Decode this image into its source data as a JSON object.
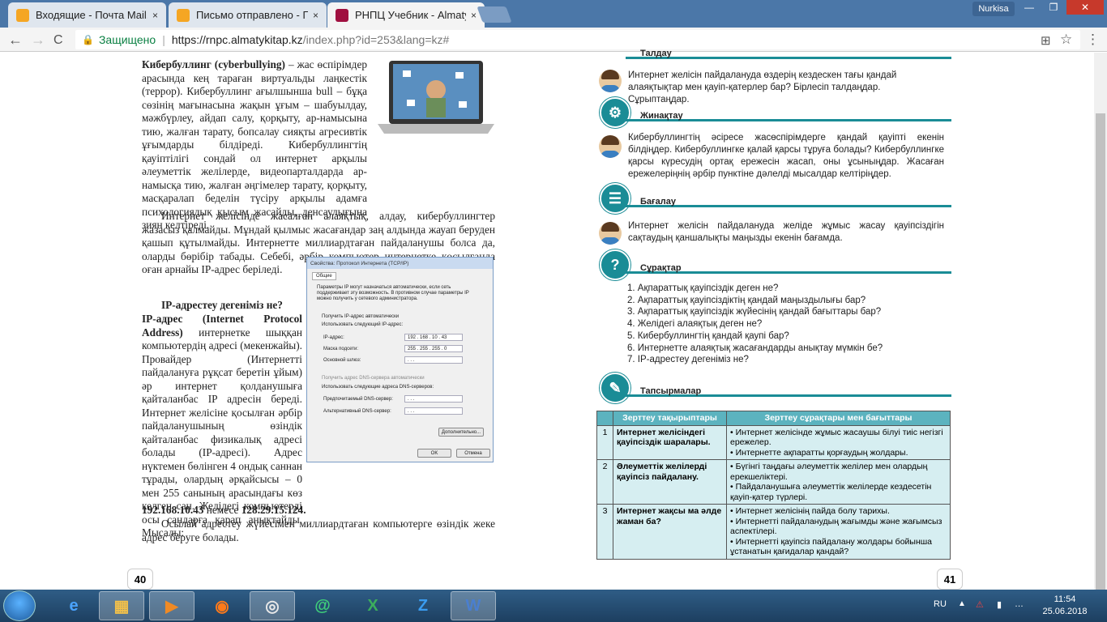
{
  "browser": {
    "tabs": [
      {
        "label": "Входящие - Почта Mail.F",
        "close": "×",
        "color": "#f5a623"
      },
      {
        "label": "Письмо отправлено - П",
        "close": "×",
        "color": "#f5a623"
      },
      {
        "label": "РНПЦ Учебник - Almaty",
        "close": "×",
        "color": "#a01040"
      }
    ],
    "user": "Nurkisa",
    "win_min": "—",
    "win_max": "❐",
    "win_close": "✕",
    "back": "←",
    "forward": "→",
    "reload": "C",
    "secure_label": "Защищено",
    "url_host": "https://rnpc.almatykitap.kz",
    "url_path": "/index.php?id=253&lang=kz#",
    "translate_icon": "⊞",
    "star_icon": "☆",
    "menu_icon": "⋮"
  },
  "left_page": {
    "p1_bold": "Кибербуллинг (cyberbullying)",
    "p1": " – жас өспірімдер арасында кең тараған виртуальды лаңкестік (террор). Кибербуллинг ағылшынша bull – бұқа сөзінің мағынасына жақын ұғым – шабуылдау, мәжбүрлеу, айдап салу, қорқыту, ар-намысына тию, жалған тарату, бопсалау сияқты агресивтік ұғымдарды білдіреді. Кибербуллингтің қауіптілігі сондай ол интернет арқылы әлеуметтік желілерде, видеопарталдарда ар-намысқа тию, жалған әңгімелер тарату, қорқыту, масқаралап беделін түсіру арқылы адамға психологиялық қысым жасайды, денсаулығына зиян келтіреді.",
    "p2": "Интернет желісінде жасалған алаяқтық, алдау, кибербуллингтер жазасыз қалмайды. Мұндай қылмыс жасағандар заң алдында жауап беруден қашып құтылмайды. Интернетте миллиардтаған пайдаланушы болса да, оларды бөрібір табады. Себебі, әрбір компьютер интернетке қосылғанда оған арнайы IP-адрес беріледі.",
    "p3": "IP-адрестеу дегеніміз не?",
    "p4_bold": "IP-адрес (Internet Protocol Address)",
    "p4": " интернетке шыққан компьютердің адресі (мекенжайы). Провайдер (Интернетті пайдалануға рұқсат беретін ұйым) әр интернет қолданушыға қайталанбас IP адресін береді. Интернет желісіне қосылған әрбір пайдаланушының өзіндік қайталанбас физикалық адресі болады (IP-адресі). Адрес нүктемен бөлінген 4 ондық саннан тұрады, олардың әрқайсысы – 0 мен 255 санының арасындағы көз келген сан. Желідегі компьютерді осы сандарға қарап анықтайды. Мысалы:",
    "p4_ex1": "192.168.10.43",
    "p4_or": " немесе ",
    "p4_ex2": "128.29.15.124.",
    "p5": "Осылай адрестеу жүйесімен миллиардтаған компьютерге өзіндік жеке адрес беруге болады.",
    "page_number": "40"
  },
  "ip_dialog": {
    "title": "Свойства: Протокол Интернета (TCP/IP)",
    "tab": "Общие",
    "desc": "Параметры IP могут назначаться автоматически, если сеть поддерживает эту возможность. В противном случае параметры IP можно получить у сетевого администратора.",
    "auto_ip": "Получить IP-адрес автоматически",
    "manual_ip": "Использовать следующий IP-адрес:",
    "ip_label": "IP-адрес:",
    "ip_value": "192 . 168 . 10 . 43",
    "mask_label": "Маска подсети:",
    "mask_value": "255 . 255 . 255 . 0",
    "gw_label": "Основной шлюз:",
    "gw_value": ". . .",
    "auto_dns": "Получить адрес DNS-сервера автоматически",
    "manual_dns": "Использовать следующие адреса DNS-серверов:",
    "dns1_label": "Предпочитаемый DNS-сервер:",
    "dns2_label": "Альтернативный DNS-сервер:",
    "dns_value": ". . .",
    "advanced": "Дополнительно...",
    "ok": "OK",
    "cancel": "Отмена"
  },
  "right_page": {
    "s1_title": "Талдау",
    "s1_text": "Интернет желісін пайдалануда өздерің кездескен тағы қандай алаяқтықтар мен қауіп-қатерлер бар? Бірлесіп талдаңдар. Сұрыптаңдар.",
    "s2_title": "Жинақтау",
    "s2_text": "Кибербуллингтің әсіресе жасөспірімдерге қандай қауіпті екенін білдіңдер. Кибербуллингке қалай қарсы тұруға болады? Кибербуллингке қарсы күресудің ортақ ережесін жасап, оны ұсыныңдар. Жасаған ережелеріңнің әрбір пунктіне дәлелді мысалдар келтіріңдер.",
    "s3_title": "Бағалау",
    "s3_text": "Интернет желісін пайдалануда желіде жұмыс жасау қауіпсіздігін сақтаудың қаншалықты маңызды екенін бағамда.",
    "s4_title": "Сұрақтар",
    "s4_icon": "?",
    "questions": [
      "1. Ақпараттық қауіпсіздік деген не?",
      "2. Ақпараттық қауіпсіздіктің қандай маңыздылығы бар?",
      "3. Ақпараттық қауіпсіздік жүйесінің қандай бағыттары бар?",
      "4. Желідегі алаяқтық деген не?",
      "5. Кибербуллингтің қандай қаупі бар?",
      "6. Интернетте алаяқтық жасағандарды анықтау мүмкін бе?",
      "7. IP-адрестеу дегеніміз не?"
    ],
    "s5_title": "Тапсырмалар",
    "table_headers": [
      "",
      "Зерттеу тақырыптары",
      "Зерттеу сұрақтары мен бағыттары"
    ],
    "table_rows": [
      {
        "num": "1",
        "topic": "Интернет желісіндегі қауіпсіздік шаралары.",
        "points": [
          "• Интернет желісінде жұмыс жасаушы білуі тиіс негізгі ережелер.",
          "• Интернетте ақпаратты қорғаудың жолдары."
        ]
      },
      {
        "num": "2",
        "topic": "Әлеуметтік желілерді қауіпсіз пайдалану.",
        "points": [
          "• Бүгінгі таңдағы әлеуметтік желілер мен олардың ерекшеліктері.",
          "• Пайдаланушыға әлеуметтік желілерде кездесетін қауіп-қатер түрлері."
        ]
      },
      {
        "num": "3",
        "topic": "Интернет жақсы ма әлде жаман ба?",
        "points": [
          "• Интернет желісінің пайда болу тарихы.",
          "• Интернетті пайдаланудың жағымды және жағымсыз аспектілері.",
          "• Интернетті қауіпсіз пайдалану жолдары бойынша ұстанатын қағидалар қандай?"
        ]
      }
    ],
    "page_number": "41"
  },
  "taskbar": {
    "lang": "RU",
    "time": "11:54",
    "date": "25.06.2018",
    "apps": [
      "e",
      "▦",
      "▶",
      "◉",
      "◎",
      "@",
      "X",
      "Z",
      "W"
    ]
  }
}
